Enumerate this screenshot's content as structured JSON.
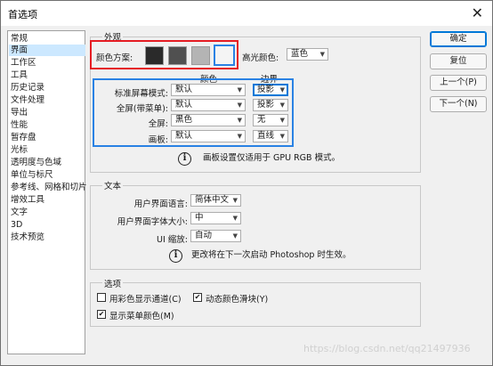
{
  "window": {
    "title": "首选项",
    "close_glyph": "✕"
  },
  "sidebar": {
    "items": [
      {
        "label": "常规"
      },
      {
        "label": "界面",
        "selected": true
      },
      {
        "label": "工作区"
      },
      {
        "label": "工具"
      },
      {
        "label": "历史记录"
      },
      {
        "label": "文件处理"
      },
      {
        "label": "导出"
      },
      {
        "label": "性能"
      },
      {
        "label": "暂存盘"
      },
      {
        "label": "光标"
      },
      {
        "label": "透明度与色域"
      },
      {
        "label": "单位与标尺"
      },
      {
        "label": "参考线、网格和切片"
      },
      {
        "label": "增效工具"
      },
      {
        "label": "文字"
      },
      {
        "label": "3D"
      },
      {
        "label": "技术预览"
      }
    ]
  },
  "appearance": {
    "group_label": "外观",
    "color_scheme_label": "颜色方案:",
    "swatches": [
      "#2a2a2a",
      "#505050",
      "#b4b4b4",
      "#f4f4f4"
    ],
    "selected_swatch": 3,
    "highlight_label": "高光颜色:",
    "highlight_value": "蓝色",
    "col_color": "颜色",
    "col_border": "边界",
    "rows": [
      {
        "label": "标准屏幕模式:",
        "color": "默认",
        "border": "投影"
      },
      {
        "label": "全屏(带菜单):",
        "color": "默认",
        "border": "投影"
      },
      {
        "label": "全屏:",
        "color": "黑色",
        "border": "无"
      },
      {
        "label": "画板:",
        "color": "默认",
        "border": "直线"
      }
    ],
    "note": "画板设置仅适用于 GPU RGB 模式。"
  },
  "text": {
    "group_label": "文本",
    "ui_language_label": "用户界面语言:",
    "ui_language_value": "简体中文",
    "ui_font_size_label": "用户界面字体大小:",
    "ui_font_size_value": "中",
    "ui_scale_label": "UI 缩放:",
    "ui_scale_value": "自动",
    "note": "更改将在下一次启动 Photoshop 时生效。"
  },
  "options": {
    "group_label": "选项",
    "items": [
      {
        "label": "用彩色显示通道(C)",
        "checked": false
      },
      {
        "label": "动态颜色滑块(Y)",
        "checked": true
      },
      {
        "label": "显示菜单颜色(M)",
        "checked": true
      }
    ]
  },
  "buttons": {
    "ok": "确定",
    "reset": "复位",
    "prev": "上一个(P)",
    "next": "下一个(N)"
  },
  "icons": {
    "dropdown": "▼",
    "check": "✔",
    "info": "i"
  },
  "watermark": "https://blog.csdn.net/qq21497936",
  "colors": {
    "red_highlight": "#e51c23",
    "blue_highlight": "#2a82e4",
    "selection": "#cce8ff",
    "accent": "#0078d7"
  }
}
